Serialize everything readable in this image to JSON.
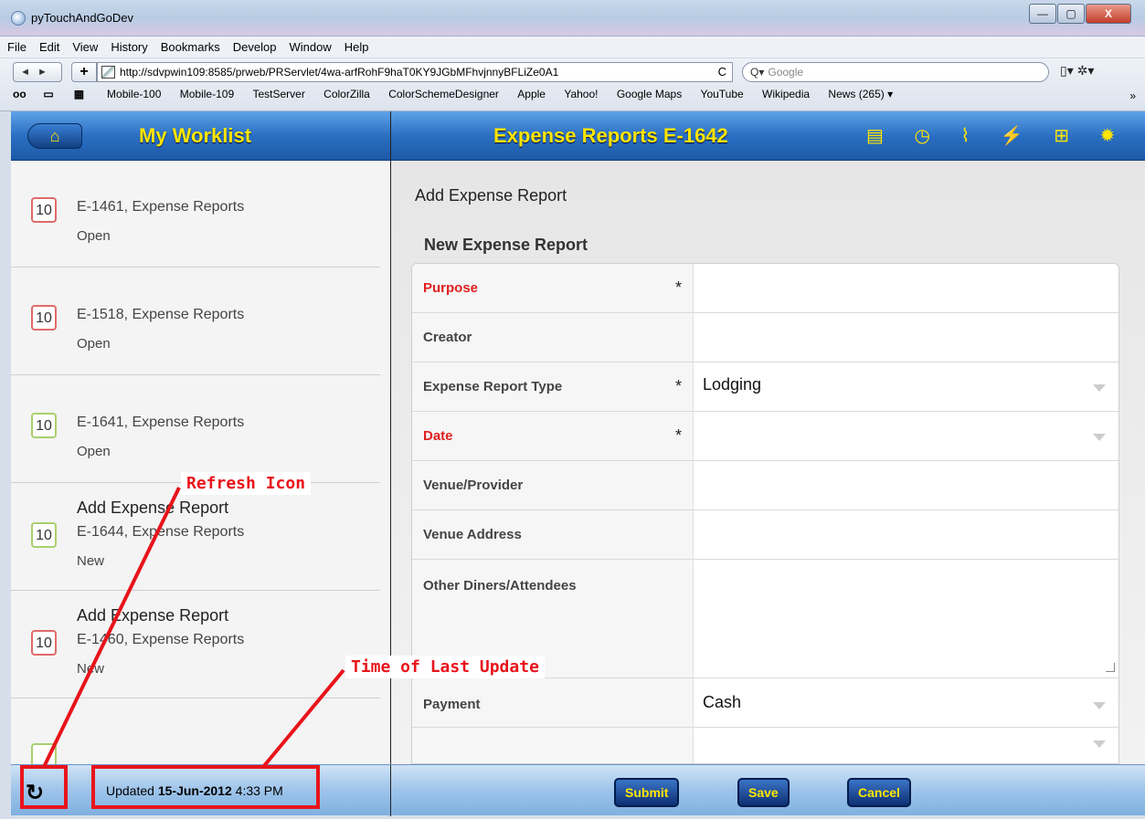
{
  "window": {
    "title": "pyTouchAndGoDev",
    "minimize": "—",
    "maximize": "▢",
    "close": "X"
  },
  "menu": [
    "File",
    "Edit",
    "View",
    "History",
    "Bookmarks",
    "Develop",
    "Window",
    "Help"
  ],
  "toolbar": {
    "back_forward": "◄►",
    "add_tab": "+",
    "url": "http://sdvpwin109:8585/prweb/PRServlet/4wa-arfRohF9haT0KY9JGbMFhvjnnyBFLiZe0A1",
    "reload": "C",
    "search_placeholder": "Google",
    "search_icon": "Q▾",
    "page_menu": "▯▾ ✲▾"
  },
  "bookmarks": {
    "icons": [
      "oo",
      "▭",
      "▦"
    ],
    "items": [
      "Mobile-100",
      "Mobile-109",
      "TestServer",
      "ColorZilla",
      "ColorSchemeDesigner",
      "Apple",
      "Yahoo!",
      "Google Maps",
      "YouTube",
      "Wikipedia",
      "News (265) ▾"
    ],
    "more": "»"
  },
  "left_header": {
    "home_icon": "⌂",
    "title": "My Worklist"
  },
  "right_header": {
    "title": "Expense Reports E-1642",
    "icons": "▤ ◷ ⌇ ⚡ ⊞ ✹"
  },
  "worklist": [
    {
      "badge": "10",
      "color": "red",
      "title": "",
      "sub": "E-1461, Expense Reports",
      "status": "Open"
    },
    {
      "badge": "10",
      "color": "red",
      "title": "",
      "sub": "E-1518, Expense Reports",
      "status": "Open"
    },
    {
      "badge": "10",
      "color": "green",
      "title": "",
      "sub": "E-1641, Expense Reports",
      "status": "Open"
    },
    {
      "badge": "10",
      "color": "green",
      "title": "Add Expense Report",
      "sub": "E-1644, Expense Reports",
      "status": "New"
    },
    {
      "badge": "10",
      "color": "red",
      "title": "Add Expense Report",
      "sub": "E-1460, Expense Reports",
      "status": "New"
    }
  ],
  "form": {
    "heading": "Add Expense Report",
    "section": "New Expense Report",
    "fields": [
      {
        "label": "Purpose",
        "required": true,
        "value": ""
      },
      {
        "label": "Creator",
        "required": false,
        "value": ""
      },
      {
        "label": "Expense Report Type",
        "required": true,
        "value": "Lodging"
      },
      {
        "label": "Date",
        "required": true,
        "value": ""
      },
      {
        "label": "Venue/Provider",
        "required": false,
        "value": ""
      },
      {
        "label": "Venue Address",
        "required": false,
        "value": ""
      },
      {
        "label": "Other Diners/Attendees",
        "required": false,
        "value": ""
      },
      {
        "label": "Payment",
        "required": false,
        "value": "Cash"
      }
    ],
    "required_mark": "*"
  },
  "footer": {
    "refresh_icon": "↻",
    "updated_prefix": "Updated",
    "updated_date": "15-Jun-2012",
    "updated_time": "4:33 PM",
    "submit": "Submit",
    "save": "Save",
    "cancel": "Cancel"
  },
  "annotations": {
    "refresh": "Refresh Icon",
    "last_update": "Time of Last Update",
    "color": "#e8141b"
  }
}
